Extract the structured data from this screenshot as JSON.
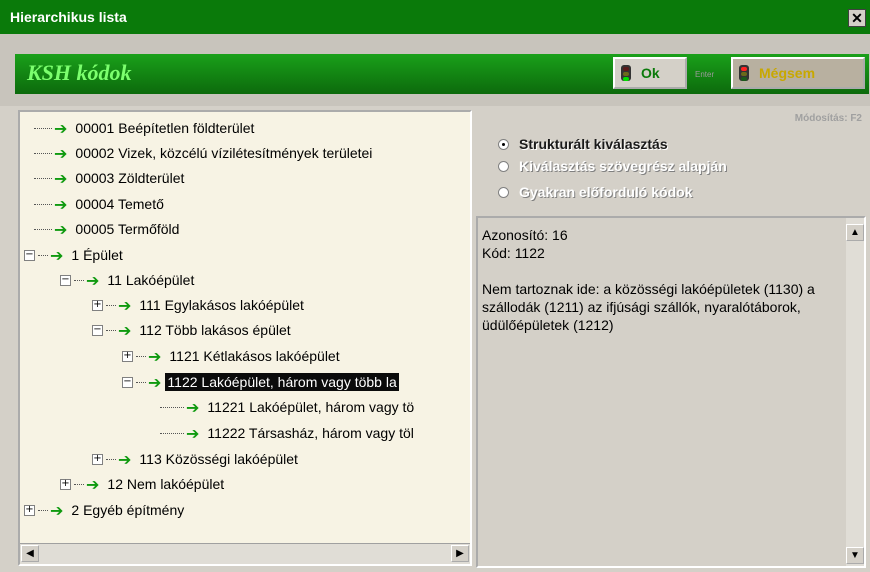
{
  "window": {
    "title": "Hierarchikus lista",
    "close_glyph": "✕"
  },
  "header": {
    "title": "KSH kódok",
    "ok_label": "Ok",
    "enter_label": "Enter",
    "cancel_label": "Mégsem"
  },
  "tree": {
    "nodes": [
      {
        "label": "00001 Beépítetlen földterület"
      },
      {
        "label": "00002 Vizek, közcélú vízilétesítmények területei"
      },
      {
        "label": "00003 Zöldterület"
      },
      {
        "label": "00004 Temető"
      },
      {
        "label": "00005 Termőföld"
      },
      {
        "label": "1 Épület"
      },
      {
        "label": "11 Lakóépület"
      },
      {
        "label": "111 Egylakásos lakóépület"
      },
      {
        "label": "112 Több lakásos épület"
      },
      {
        "label": "1121 Kétlakásos lakóépület"
      },
      {
        "label": "1122 Lakóépület, három vagy több la"
      },
      {
        "label": "11221 Lakóépület, három vagy tö"
      },
      {
        "label": "11222 Társasház, három vagy töl"
      },
      {
        "label": "113 Közösségi lakóépület"
      },
      {
        "label": "12 Nem lakóépület"
      },
      {
        "label": "2 Egyéb építmény"
      }
    ]
  },
  "options": {
    "modify_hint": "Módosítás: F2",
    "radios": [
      {
        "label": "Strukturált kiválasztás"
      },
      {
        "label": "Kiválasztás szövegrész alapján"
      },
      {
        "label": "Gyakran előforduló kódok"
      }
    ]
  },
  "detail": {
    "line1": "Azonosító: 16",
    "line2": "Kód: 1122",
    "body": "Nem tartoznak ide: a közösségi lakóépületek (1130) a szállodák (1211) az ifjúsági szállók, nyaralótáborok, üdülőépületek (1212)"
  },
  "colors": {
    "title_bar": "#0a7a0a",
    "header_band": "#1aa01a",
    "arrow": "#0f9a0f",
    "selection": "#0b0b0b",
    "tree_bg": "#f7f3e4"
  }
}
